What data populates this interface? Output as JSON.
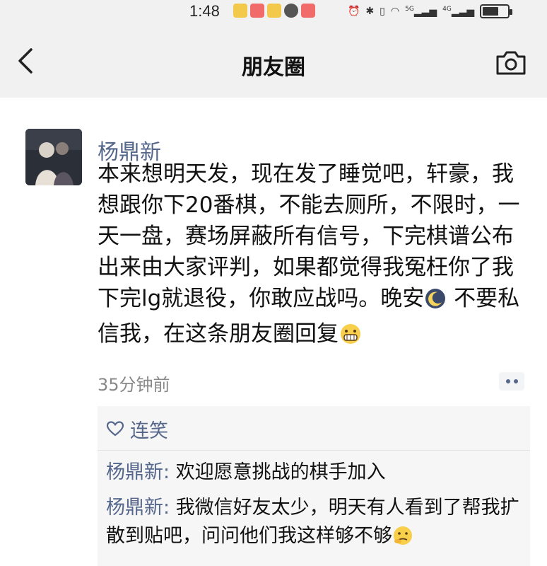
{
  "status_bar": {
    "time": "1:48",
    "signal_labels": [
      "5G",
      "4G"
    ]
  },
  "nav": {
    "title": "朋友圈",
    "back_icon": "chevron-left-icon",
    "camera_icon": "camera-icon"
  },
  "post": {
    "author": "杨鼎新",
    "content_main": "本来想明天发，现在发了睡觉吧，轩豪，我想跟你下20番棋，不能去厕所，不限时，一天一盘，赛场屏蔽所有信号，下完棋谱公布出来由大家评判，如果都觉得我冤枉你了我下完lg就退役，你敢应战吗。",
    "content_goodnight": "晚安",
    "content_tail": " 不要私信我，在这条朋友圈回复",
    "timestamp": "35分钟前"
  },
  "likes": {
    "icon": "heart-outline-icon",
    "names": "连笑"
  },
  "comments": [
    {
      "author": "杨鼎新",
      "separator": ": ",
      "text": "欢迎愿意挑战的棋手加入"
    },
    {
      "author": "杨鼎新",
      "separator": ": ",
      "text": "我微信好友太少，明天有人看到了帮我扩散到贴吧，问问他们我这样够不够"
    }
  ],
  "colors": {
    "link_blue": "#56678c",
    "bar_bg": "#f1f1f1",
    "comment_bg": "#f6f6f6"
  }
}
